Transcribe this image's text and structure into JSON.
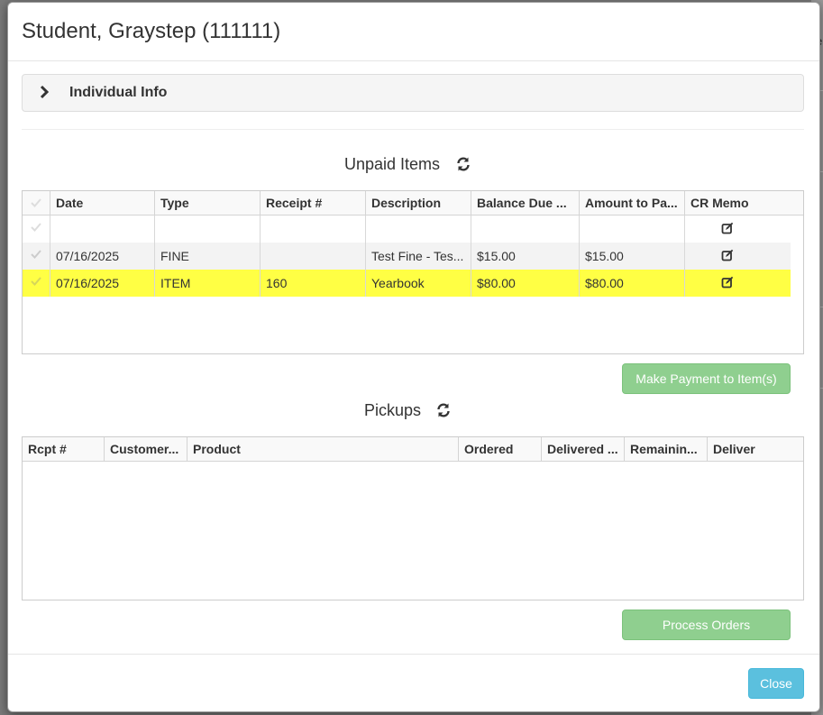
{
  "modal": {
    "title": "Student, Graystep (111111)",
    "individual_info_label": "Individual Info"
  },
  "unpaid": {
    "title": "Unpaid Items",
    "columns": [
      "Date",
      "Type",
      "Receipt #",
      "Description",
      "Balance Due ...",
      "Amount to Pa...",
      "CR Memo"
    ],
    "rows": [
      {
        "date": "",
        "type": "",
        "receipt": "",
        "description": "",
        "balance": "",
        "amount": "",
        "highlight": false
      },
      {
        "date": "07/16/2025",
        "type": "FINE",
        "receipt": "",
        "description": "Test Fine - Tes...",
        "balance": "$15.00",
        "amount": "$15.00",
        "highlight": false
      },
      {
        "date": "07/16/2025",
        "type": "ITEM",
        "receipt": "160",
        "description": "Yearbook",
        "balance": "$80.00",
        "amount": "$80.00",
        "highlight": true
      }
    ],
    "make_payment_label": "Make Payment to Item(s)"
  },
  "pickups": {
    "title": "Pickups",
    "columns": [
      "Rcpt #",
      "Customer...",
      "Product",
      "Ordered",
      "Delivered ...",
      "Remainin...",
      "Deliver"
    ],
    "process_orders_label": "Process Orders"
  },
  "footer": {
    "close_label": "Close"
  },
  "background_peek": "e",
  "colors": {
    "highlight": "#ffff44",
    "green_button": "#8fcf8f",
    "close_button": "#5bc0de"
  },
  "icons": [
    "chevron-right-icon",
    "refresh-icon",
    "checkmark-icon",
    "edit-icon"
  ]
}
